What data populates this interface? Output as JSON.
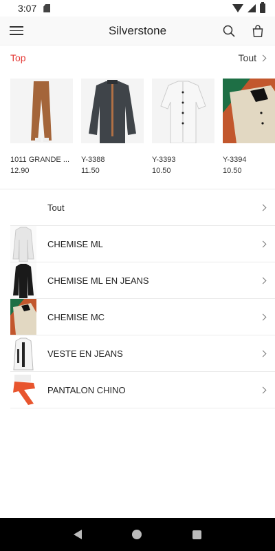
{
  "status": {
    "time": "3:07"
  },
  "app": {
    "title": "Silverstone"
  },
  "top_section": {
    "label": "Top",
    "see_all": "Tout"
  },
  "products": [
    {
      "name": "1011 GRANDE ...",
      "price": "12.90",
      "color": "#a4653a"
    },
    {
      "name": "Y-3388",
      "price": "11.50",
      "color": "#3f4449"
    },
    {
      "name": "Y-3393",
      "price": "10.50",
      "color": "#ececec"
    },
    {
      "name": "Y-3394",
      "price": "10.50",
      "color": "#d9cfb8"
    }
  ],
  "categories": {
    "all_label": "Tout",
    "items": [
      {
        "label": "CHEMISE ML",
        "color": "#e9e9e9"
      },
      {
        "label": "CHEMISE ML EN JEANS",
        "color": "#1a1a1a"
      },
      {
        "label": "CHEMISE MC",
        "color": "#cdbfa6"
      },
      {
        "label": "VESTE EN JEANS",
        "color": "#f2f2f2"
      },
      {
        "label": "PANTALON CHINO",
        "color": "#e8552e"
      }
    ]
  },
  "icons": {
    "menu": "hamburger-icon",
    "search": "search-icon",
    "cart": "shopping-bag-icon",
    "chevron": "chevron-right-icon"
  },
  "colors": {
    "accent": "#e53935",
    "nav_bar": "#000000"
  }
}
